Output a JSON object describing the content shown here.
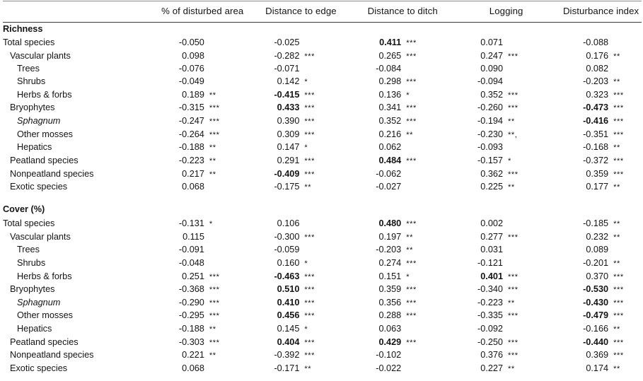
{
  "table": {
    "columns": [
      {
        "key": "disturbed_area",
        "label": "% of disturbed area"
      },
      {
        "key": "distance_edge",
        "label": "Distance to edge"
      },
      {
        "key": "distance_ditch",
        "label": "Distance to ditch"
      },
      {
        "key": "logging",
        "label": "Logging"
      },
      {
        "key": "disturbance_index",
        "label": "Disturbance index"
      }
    ],
    "row_label_header": "",
    "sections": [
      {
        "title": "Richness",
        "rows": [
          {
            "label": "Total species",
            "indent": 0,
            "italic": false,
            "cells": [
              {
                "value": "-0.050",
                "sig": "",
                "bold": false
              },
              {
                "value": "-0.025",
                "sig": "",
                "bold": false
              },
              {
                "value": "0.411",
                "sig": "***",
                "bold": true
              },
              {
                "value": "0.071",
                "sig": "",
                "bold": false
              },
              {
                "value": "-0.088",
                "sig": "",
                "bold": false
              }
            ]
          },
          {
            "label": "Vascular plants",
            "indent": 1,
            "italic": false,
            "cells": [
              {
                "value": "0.098",
                "sig": "",
                "bold": false
              },
              {
                "value": "-0.282",
                "sig": "***",
                "bold": false
              },
              {
                "value": "0.265",
                "sig": "***",
                "bold": false
              },
              {
                "value": "0.247",
                "sig": "***",
                "bold": false
              },
              {
                "value": "0.176",
                "sig": "**",
                "bold": false
              }
            ]
          },
          {
            "label": "Trees",
            "indent": 2,
            "italic": false,
            "cells": [
              {
                "value": "-0.076",
                "sig": "",
                "bold": false
              },
              {
                "value": "-0.071",
                "sig": "",
                "bold": false
              },
              {
                "value": "-0.084",
                "sig": "",
                "bold": false
              },
              {
                "value": "0.090",
                "sig": "",
                "bold": false
              },
              {
                "value": "0.082",
                "sig": "",
                "bold": false
              }
            ]
          },
          {
            "label": "Shrubs",
            "indent": 2,
            "italic": false,
            "cells": [
              {
                "value": "-0.049",
                "sig": "",
                "bold": false
              },
              {
                "value": "0.142",
                "sig": "*",
                "bold": false
              },
              {
                "value": "0.298",
                "sig": "***",
                "bold": false
              },
              {
                "value": "-0.094",
                "sig": "",
                "bold": false
              },
              {
                "value": "-0.203",
                "sig": "**",
                "bold": false
              }
            ]
          },
          {
            "label": "Herbs & forbs",
            "indent": 2,
            "italic": false,
            "cells": [
              {
                "value": "0.189",
                "sig": "**",
                "bold": false
              },
              {
                "value": "-0.415",
                "sig": "***",
                "bold": true
              },
              {
                "value": "0.136",
                "sig": "*",
                "bold": false
              },
              {
                "value": "0.352",
                "sig": "***",
                "bold": false
              },
              {
                "value": "0.323",
                "sig": "***",
                "bold": false
              }
            ]
          },
          {
            "label": "Bryophytes",
            "indent": 1,
            "italic": false,
            "cells": [
              {
                "value": "-0.315",
                "sig": "***",
                "bold": false
              },
              {
                "value": "0.433",
                "sig": "***",
                "bold": true
              },
              {
                "value": "0.341",
                "sig": "***",
                "bold": false
              },
              {
                "value": "-0.260",
                "sig": "***",
                "bold": false
              },
              {
                "value": "-0.473",
                "sig": "***",
                "bold": true
              }
            ]
          },
          {
            "label": "Sphagnum",
            "indent": 2,
            "italic": true,
            "cells": [
              {
                "value": "-0.247",
                "sig": "***",
                "bold": false
              },
              {
                "value": "0.390",
                "sig": "***",
                "bold": false
              },
              {
                "value": "0.352",
                "sig": "***",
                "bold": false
              },
              {
                "value": "-0.194",
                "sig": "**",
                "bold": false
              },
              {
                "value": "-0.416",
                "sig": "***",
                "bold": true
              }
            ]
          },
          {
            "label": "Other mosses",
            "indent": 2,
            "italic": false,
            "cells": [
              {
                "value": "-0.264",
                "sig": "***",
                "bold": false
              },
              {
                "value": "0.309",
                "sig": "***",
                "bold": false
              },
              {
                "value": "0.216",
                "sig": "**",
                "bold": false
              },
              {
                "value": "-0.230",
                "sig": "**,",
                "bold": false
              },
              {
                "value": "-0.351",
                "sig": "***",
                "bold": false
              }
            ]
          },
          {
            "label": "Hepatics",
            "indent": 2,
            "italic": false,
            "cells": [
              {
                "value": "-0.188",
                "sig": "**",
                "bold": false
              },
              {
                "value": "0.147",
                "sig": "*",
                "bold": false
              },
              {
                "value": "0.062",
                "sig": "",
                "bold": false
              },
              {
                "value": "-0.093",
                "sig": "",
                "bold": false
              },
              {
                "value": "-0.168",
                "sig": "**",
                "bold": false
              }
            ]
          },
          {
            "label": "Peatland species",
            "indent": 1,
            "italic": false,
            "cells": [
              {
                "value": "-0.223",
                "sig": "**",
                "bold": false
              },
              {
                "value": "0.291",
                "sig": "***",
                "bold": false
              },
              {
                "value": "0.484",
                "sig": "***",
                "bold": true
              },
              {
                "value": "-0.157",
                "sig": "*",
                "bold": false
              },
              {
                "value": "-0.372",
                "sig": "***",
                "bold": false
              }
            ]
          },
          {
            "label": "Nonpeatland species",
            "indent": 1,
            "italic": false,
            "cells": [
              {
                "value": "0.217",
                "sig": "**",
                "bold": false
              },
              {
                "value": "-0.409",
                "sig": "***",
                "bold": true
              },
              {
                "value": "-0.062",
                "sig": "",
                "bold": false
              },
              {
                "value": "0.362",
                "sig": "***",
                "bold": false
              },
              {
                "value": "0.359",
                "sig": "***",
                "bold": false
              }
            ]
          },
          {
            "label": "Exotic species",
            "indent": 1,
            "italic": false,
            "cells": [
              {
                "value": "0.068",
                "sig": "",
                "bold": false
              },
              {
                "value": "-0.175",
                "sig": "**",
                "bold": false
              },
              {
                "value": "-0.027",
                "sig": "",
                "bold": false
              },
              {
                "value": "0.225",
                "sig": "**",
                "bold": false
              },
              {
                "value": "0.177",
                "sig": "**",
                "bold": false
              }
            ]
          }
        ]
      },
      {
        "title": "Cover (%)",
        "rows": [
          {
            "label": "Total species",
            "indent": 0,
            "italic": false,
            "cells": [
              {
                "value": "-0.131",
                "sig": "*",
                "bold": false
              },
              {
                "value": "0.106",
                "sig": "",
                "bold": false
              },
              {
                "value": "0.480",
                "sig": "***",
                "bold": true
              },
              {
                "value": "0.002",
                "sig": "",
                "bold": false
              },
              {
                "value": "-0.185",
                "sig": "**",
                "bold": false
              }
            ]
          },
          {
            "label": "Vascular plants",
            "indent": 1,
            "italic": false,
            "cells": [
              {
                "value": "0.115",
                "sig": "",
                "bold": false
              },
              {
                "value": "-0.300",
                "sig": "***",
                "bold": false
              },
              {
                "value": "0.197",
                "sig": "**",
                "bold": false
              },
              {
                "value": "0.277",
                "sig": "***",
                "bold": false
              },
              {
                "value": "0.232",
                "sig": "**",
                "bold": false
              }
            ]
          },
          {
            "label": "Trees",
            "indent": 2,
            "italic": false,
            "cells": [
              {
                "value": "-0.091",
                "sig": "",
                "bold": false
              },
              {
                "value": "-0.059",
                "sig": "",
                "bold": false
              },
              {
                "value": "-0.203",
                "sig": "**",
                "bold": false
              },
              {
                "value": "0.031",
                "sig": "",
                "bold": false
              },
              {
                "value": "0.089",
                "sig": "",
                "bold": false
              }
            ]
          },
          {
            "label": "Shrubs",
            "indent": 2,
            "italic": false,
            "cells": [
              {
                "value": "-0.048",
                "sig": "",
                "bold": false
              },
              {
                "value": "0.160",
                "sig": "*",
                "bold": false
              },
              {
                "value": "0.274",
                "sig": "***",
                "bold": false
              },
              {
                "value": "-0.121",
                "sig": "",
                "bold": false
              },
              {
                "value": "-0.201",
                "sig": "**",
                "bold": false
              }
            ]
          },
          {
            "label": "Herbs & forbs",
            "indent": 2,
            "italic": false,
            "cells": [
              {
                "value": "0.251",
                "sig": "***",
                "bold": false
              },
              {
                "value": "-0.463",
                "sig": "***",
                "bold": true
              },
              {
                "value": "0.151",
                "sig": "*",
                "bold": false
              },
              {
                "value": "0.401",
                "sig": "***",
                "bold": true
              },
              {
                "value": "0.370",
                "sig": "***",
                "bold": false
              }
            ]
          },
          {
            "label": "Bryophytes",
            "indent": 1,
            "italic": false,
            "cells": [
              {
                "value": "-0.368",
                "sig": "***",
                "bold": false
              },
              {
                "value": "0.510",
                "sig": "***",
                "bold": true
              },
              {
                "value": "0.359",
                "sig": "***",
                "bold": false
              },
              {
                "value": "-0.340",
                "sig": "***",
                "bold": false
              },
              {
                "value": "-0.530",
                "sig": "***",
                "bold": true
              }
            ]
          },
          {
            "label": "Sphagnum",
            "indent": 2,
            "italic": true,
            "cells": [
              {
                "value": "-0.290",
                "sig": "***",
                "bold": false
              },
              {
                "value": "0.410",
                "sig": "***",
                "bold": true
              },
              {
                "value": "0.356",
                "sig": "***",
                "bold": false
              },
              {
                "value": "-0.223",
                "sig": "**",
                "bold": false
              },
              {
                "value": "-0.430",
                "sig": "***",
                "bold": true
              }
            ]
          },
          {
            "label": "Other mosses",
            "indent": 2,
            "italic": false,
            "cells": [
              {
                "value": "-0.295",
                "sig": "***",
                "bold": false
              },
              {
                "value": "0.456",
                "sig": "***",
                "bold": true
              },
              {
                "value": "0.288",
                "sig": "***",
                "bold": false
              },
              {
                "value": "-0.335",
                "sig": "***",
                "bold": false
              },
              {
                "value": "-0.479",
                "sig": "***",
                "bold": true
              }
            ]
          },
          {
            "label": "Hepatics",
            "indent": 2,
            "italic": false,
            "cells": [
              {
                "value": "-0.188",
                "sig": "**",
                "bold": false
              },
              {
                "value": "0.145",
                "sig": "*",
                "bold": false
              },
              {
                "value": "0.063",
                "sig": "",
                "bold": false
              },
              {
                "value": "-0.092",
                "sig": "",
                "bold": false
              },
              {
                "value": "-0.166",
                "sig": "**",
                "bold": false
              }
            ]
          },
          {
            "label": "Peatland species",
            "indent": 1,
            "italic": false,
            "cells": [
              {
                "value": "-0.303",
                "sig": "***",
                "bold": false
              },
              {
                "value": "0.404",
                "sig": "***",
                "bold": true
              },
              {
                "value": "0.429",
                "sig": "***",
                "bold": true
              },
              {
                "value": "-0.250",
                "sig": "***",
                "bold": false
              },
              {
                "value": "-0.440",
                "sig": "***",
                "bold": true
              }
            ]
          },
          {
            "label": "Nonpeatland species",
            "indent": 1,
            "italic": false,
            "cells": [
              {
                "value": "0.221",
                "sig": "**",
                "bold": false
              },
              {
                "value": "-0.392",
                "sig": "***",
                "bold": false
              },
              {
                "value": "-0.102",
                "sig": "",
                "bold": false
              },
              {
                "value": "0.376",
                "sig": "***",
                "bold": false
              },
              {
                "value": "0.369",
                "sig": "***",
                "bold": false
              }
            ]
          },
          {
            "label": "Exotic species",
            "indent": 1,
            "italic": false,
            "cells": [
              {
                "value": "0.068",
                "sig": "",
                "bold": false
              },
              {
                "value": "-0.171",
                "sig": "**",
                "bold": false
              },
              {
                "value": "-0.022",
                "sig": "",
                "bold": false
              },
              {
                "value": "0.227",
                "sig": "**",
                "bold": false
              },
              {
                "value": "0.174",
                "sig": "**",
                "bold": false
              }
            ]
          }
        ]
      }
    ]
  }
}
